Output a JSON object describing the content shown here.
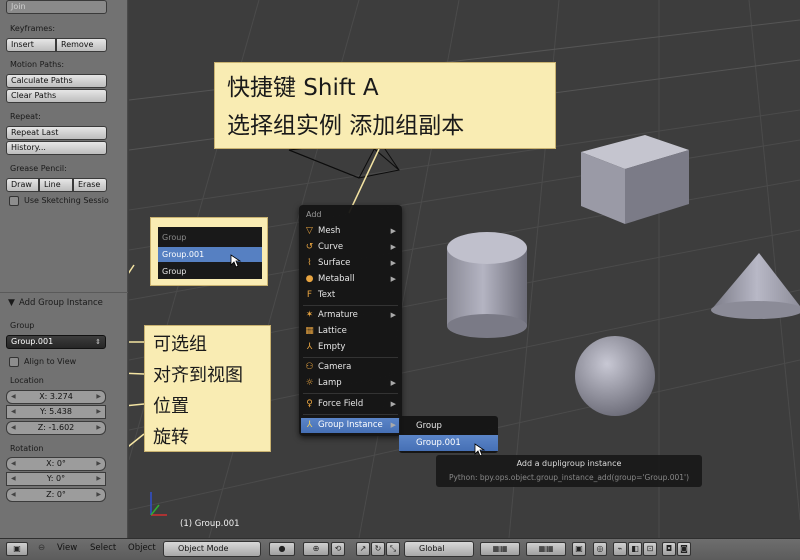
{
  "left_panel": {
    "join_label": "Join",
    "keyframes_label": "Keyframes:",
    "insert_label": "Insert",
    "remove_label": "Remove",
    "motion_paths_label": "Motion Paths:",
    "calculate_paths_label": "Calculate Paths",
    "clear_paths_label": "Clear Paths",
    "repeat_label": "Repeat:",
    "repeat_last_label": "Repeat Last",
    "history_label": "History...",
    "grease_pencil_label": "Grease Pencil:",
    "draw_label": "Draw",
    "line_label": "Line",
    "erase_label": "Erase",
    "use_sketching_label": "Use Sketching Sessio"
  },
  "operator_panel": {
    "title": "Add Group Instance",
    "group_label": "Group",
    "group_value": "Group.001",
    "align_to_view_label": "Align to View",
    "location_label": "Location",
    "location": [
      "X: 3.274",
      "Y: 5.438",
      "Z: -1.602"
    ],
    "rotation_label": "Rotation",
    "rotation": [
      "X: 0°",
      "Y: 0°",
      "Z: 0°"
    ]
  },
  "group_popup": {
    "header": "Group",
    "items": [
      "Group.001",
      "Group"
    ]
  },
  "add_menu": {
    "header": "Add",
    "items": [
      "Mesh",
      "Curve",
      "Surface",
      "Metaball",
      "Text",
      "Armature",
      "Lattice",
      "Empty",
      "Camera",
      "Lamp",
      "Force Field",
      "Group Instance"
    ]
  },
  "group_submenu": {
    "items": [
      "Group",
      "Group.001"
    ]
  },
  "tooltip": {
    "title": "Add a dupligroup instance",
    "python": "Python: bpy.ops.object.group_instance_add(group='Group.001')"
  },
  "annotations": {
    "shortcut_line1": "快捷键 Shift A",
    "shortcut_line2": "选择组实例  添加组副本",
    "label_lines": [
      "可选组",
      "对齐到视图",
      "位置",
      "旋转"
    ]
  },
  "status": {
    "selected": "(1) Group.001"
  },
  "bottom_bar": {
    "view": "View",
    "select": "Select",
    "object": "Object",
    "mode": "Object Mode",
    "orientation": "Global"
  },
  "colors": {
    "highlight": "#5680c2",
    "note_bg": "#f9ecb3",
    "viewport_bg": "#3d3d3d"
  }
}
